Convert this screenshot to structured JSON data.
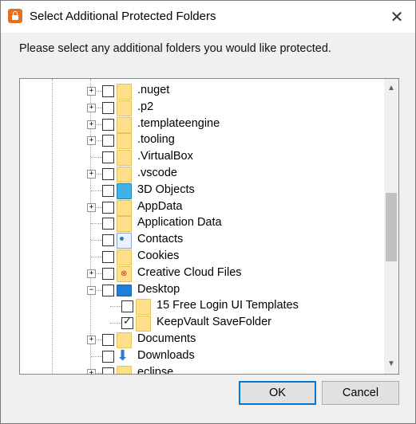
{
  "window": {
    "title": "Select Additional Protected Folders",
    "close_glyph": "✕"
  },
  "instruction": "Please select any additional folders you would like protected.",
  "tree": {
    "items": [
      {
        "label": ".nuget",
        "expander": "+",
        "checked": false,
        "icon": "folder-icon",
        "level": 0
      },
      {
        "label": ".p2",
        "expander": "+",
        "checked": false,
        "icon": "folder-icon",
        "level": 0
      },
      {
        "label": ".templateengine",
        "expander": "+",
        "checked": false,
        "icon": "folder-icon",
        "level": 0
      },
      {
        "label": ".tooling",
        "expander": "+",
        "checked": false,
        "icon": "folder-icon",
        "level": 0
      },
      {
        "label": ".VirtualBox",
        "expander": "",
        "checked": false,
        "icon": "folder-icon",
        "level": 0
      },
      {
        "label": ".vscode",
        "expander": "+",
        "checked": false,
        "icon": "folder-icon",
        "level": 0
      },
      {
        "label": "3D Objects",
        "expander": "",
        "checked": false,
        "icon": "3d-objects-icon",
        "level": 0
      },
      {
        "label": "AppData",
        "expander": "+",
        "checked": false,
        "icon": "folder-icon",
        "level": 0
      },
      {
        "label": "Application Data",
        "expander": "",
        "checked": false,
        "icon": "folder-icon",
        "level": 0
      },
      {
        "label": "Contacts",
        "expander": "",
        "checked": false,
        "icon": "contacts-icon",
        "level": 0
      },
      {
        "label": "Cookies",
        "expander": "",
        "checked": false,
        "icon": "folder-icon",
        "level": 0
      },
      {
        "label": "Creative Cloud Files",
        "expander": "+",
        "checked": false,
        "icon": "creative-cloud-icon",
        "level": 0
      },
      {
        "label": "Desktop",
        "expander": "−",
        "checked": false,
        "icon": "desktop-icon",
        "level": 0
      },
      {
        "label": "15 Free Login UI Templates",
        "expander": "",
        "checked": false,
        "icon": "folder-icon",
        "level": 1
      },
      {
        "label": "KeepVault SaveFolder",
        "expander": "",
        "checked": true,
        "icon": "folder-icon",
        "level": 1
      },
      {
        "label": "Documents",
        "expander": "+",
        "checked": false,
        "icon": "folder-icon",
        "level": 0
      },
      {
        "label": "Downloads",
        "expander": "",
        "checked": false,
        "icon": "downloads-icon",
        "level": 0
      },
      {
        "label": "eclipse",
        "expander": "+",
        "checked": false,
        "icon": "folder-icon",
        "level": 0
      }
    ]
  },
  "scrollbar": {
    "up_glyph": "▲",
    "down_glyph": "▼"
  },
  "buttons": {
    "ok": "OK",
    "cancel": "Cancel"
  }
}
